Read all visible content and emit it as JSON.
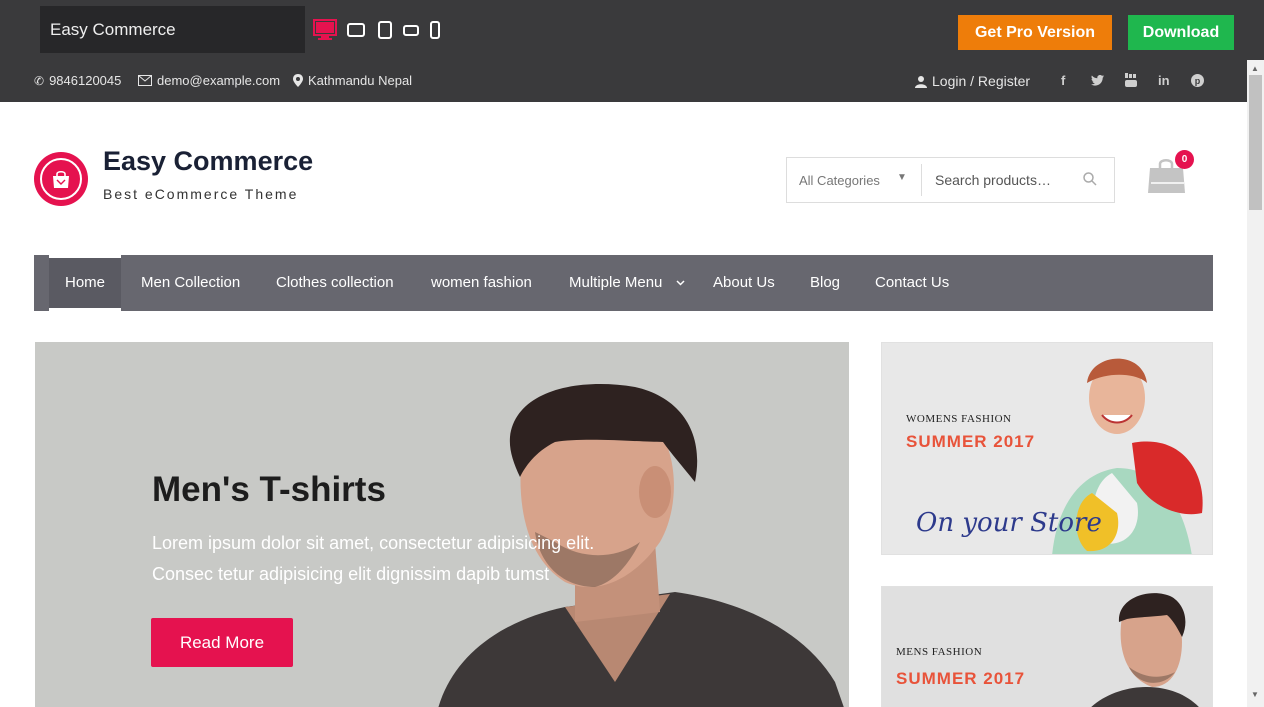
{
  "demo_bar": {
    "theme_name": "Easy Commerce",
    "pro_label": "Get Pro Version",
    "download_label": "Download",
    "devices": [
      "desktop-icon",
      "tablet-landscape-icon",
      "tablet-portrait-icon",
      "mobile-landscape-icon",
      "mobile-portrait-icon"
    ],
    "active_color": "#e5124f"
  },
  "topbar": {
    "phone": "9846120045",
    "email": "demo@example.com",
    "location": "Kathmandu Nepal",
    "login": "Login / Register",
    "social": [
      "f",
      "t",
      "yt",
      "in",
      "p"
    ]
  },
  "header": {
    "title": "Easy Commerce",
    "tagline": "Best eCommerce Theme",
    "category_select": "All Categories",
    "search_placeholder": "Search products…",
    "cart_count": "0"
  },
  "nav": {
    "items": [
      "Home",
      "Men Collection",
      "Clothes collection",
      "women fashion",
      "Multiple Menu",
      "About Us",
      "Blog",
      "Contact Us"
    ]
  },
  "hero": {
    "title": "Men's T-shirts",
    "line1": "Lorem ipsum dolor sit amet, consectetur adipisicing elit.",
    "line2": "Consec tetur adipisicing elit dignissim dapib tumst",
    "button": "Read More"
  },
  "banners": {
    "women": {
      "small": "WOMENS FASHION",
      "big": "SUMMER 2017",
      "script": "On your Store"
    },
    "men": {
      "small": "MENS FASHION",
      "big": "SUMMER 2017"
    }
  },
  "colors": {
    "brand": "#e5124f",
    "nav": "#67676f",
    "topbar": "#3a3a3c",
    "pro": "#ee7d0a",
    "download": "#1fb74e"
  }
}
